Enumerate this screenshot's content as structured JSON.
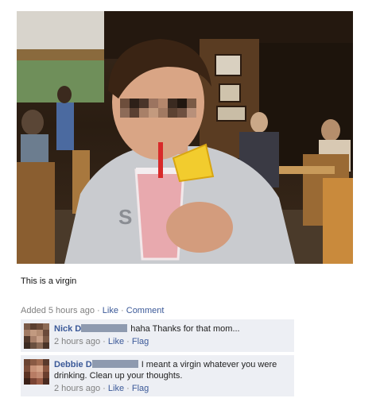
{
  "post": {
    "caption": "This is a virgin",
    "meta": {
      "added": "Added 5 hours ago",
      "like_label": "Like",
      "comment_label": "Comment",
      "separator": "·"
    }
  },
  "comments": [
    {
      "author": "Nick D",
      "text": "haha Thanks for that mom...",
      "time": "2 hours ago",
      "like_label": "Like",
      "flag_label": "Flag"
    },
    {
      "author": "Debbie D",
      "text": "I meant a virgin whatever you were drinking. Clean up your thoughts.",
      "time": "2 hours ago",
      "like_label": "Like",
      "flag_label": "Flag"
    }
  ],
  "colors": {
    "link": "#3b5998",
    "muted": "#808080",
    "comment_bg": "#edeff4"
  }
}
